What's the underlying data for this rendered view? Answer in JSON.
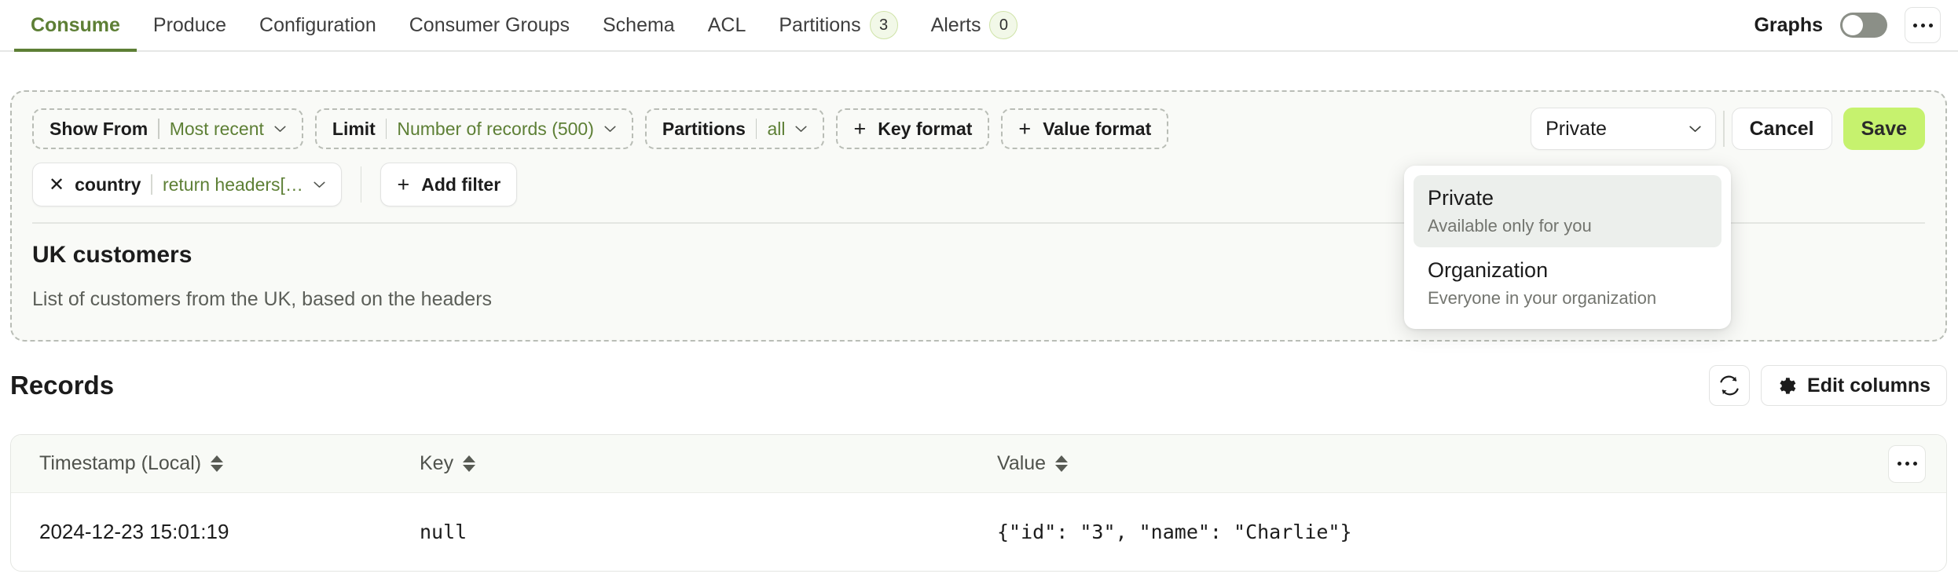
{
  "tabs": [
    {
      "label": "Consume",
      "active": true,
      "badge": null
    },
    {
      "label": "Produce",
      "active": false,
      "badge": null
    },
    {
      "label": "Configuration",
      "active": false,
      "badge": null
    },
    {
      "label": "Consumer Groups",
      "active": false,
      "badge": null
    },
    {
      "label": "Schema",
      "active": false,
      "badge": null
    },
    {
      "label": "ACL",
      "active": false,
      "badge": null
    },
    {
      "label": "Partitions",
      "active": false,
      "badge": "3"
    },
    {
      "label": "Alerts",
      "active": false,
      "badge": "0"
    }
  ],
  "header": {
    "graphs_label": "Graphs",
    "graphs_toggle_on": false,
    "overflow_icon": "ellipsis-icon"
  },
  "query": {
    "show_from": {
      "label": "Show From",
      "value": "Most recent"
    },
    "limit": {
      "label": "Limit",
      "value": "Number of records (500)"
    },
    "partitions": {
      "label": "Partitions",
      "value": "all"
    },
    "key_format": "Key format",
    "value_format": "Value format",
    "plus": "+",
    "filter": {
      "label": "country",
      "value": "return headers[…",
      "remove_icon": "close-icon"
    },
    "add_filter": "Add filter",
    "visibility_selected": "Private",
    "cancel": "Cancel",
    "save": "Save",
    "title": "UK customers",
    "description": "List of customers from the UK, based on the headers"
  },
  "visibility_dropdown": {
    "options": [
      {
        "title": "Private",
        "subtitle": "Available only for you",
        "selected": true
      },
      {
        "title": "Organization",
        "subtitle": "Everyone in your organization",
        "selected": false
      }
    ]
  },
  "records": {
    "title": "Records",
    "refresh_icon": "refresh-icon",
    "edit_columns": "Edit columns",
    "gear_icon": "gear-icon",
    "columns": [
      {
        "label": "Timestamp (Local)",
        "sortable": true
      },
      {
        "label": "Key",
        "sortable": true
      },
      {
        "label": "Value",
        "sortable": true
      }
    ],
    "rows": [
      {
        "timestamp": "2024-12-23 15:01:19",
        "key": "null",
        "value": "{\"id\": \"3\", \"name\": \"Charlie\"}"
      }
    ]
  },
  "colors": {
    "accent_green": "#5d7f35",
    "save_green": "#c6f26e",
    "badge_bg": "#f2f8e8",
    "panel_bg": "#f9faf7"
  }
}
